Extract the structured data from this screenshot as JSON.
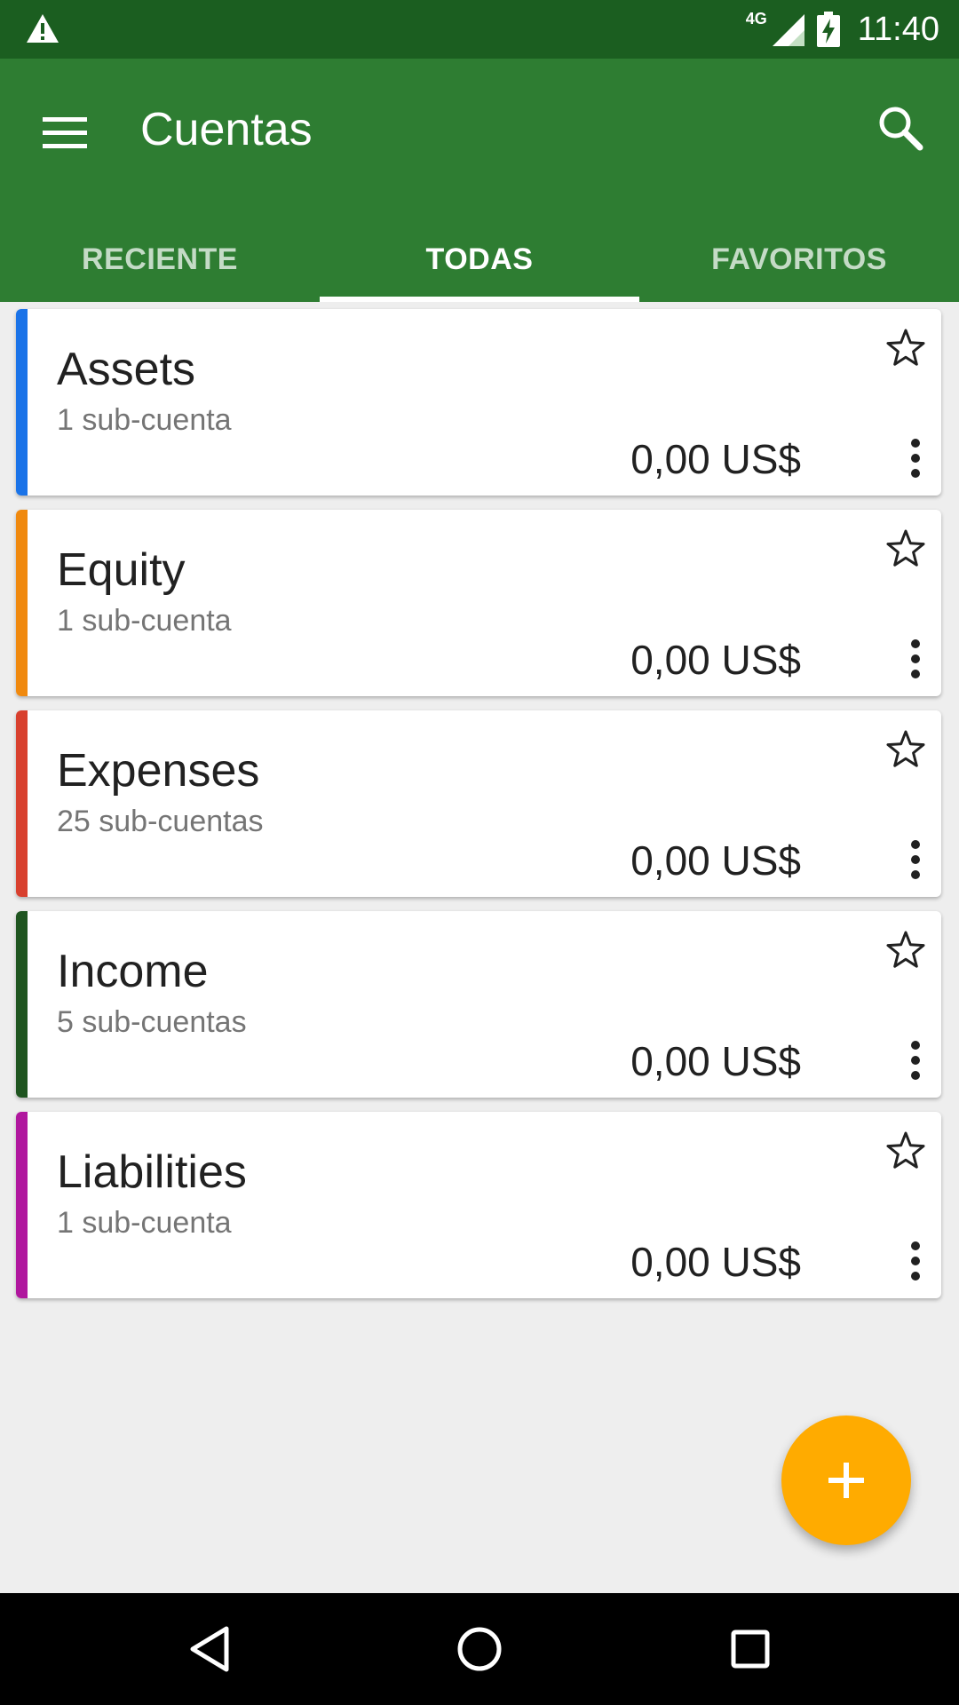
{
  "status_bar": {
    "network": "4G",
    "time": "11:40",
    "icons": [
      "warning-icon",
      "signal-icon",
      "battery-charging-icon"
    ]
  },
  "toolbar": {
    "title": "Cuentas",
    "menu_icon": "hamburger-menu-icon",
    "search_icon": "search-icon"
  },
  "tabs": [
    {
      "label": "RECIENTE",
      "active": false
    },
    {
      "label": "TODAS",
      "active": true
    },
    {
      "label": "FAVORITOS",
      "active": false
    }
  ],
  "accounts": [
    {
      "name": "Assets",
      "sub": "1 sub-cuenta",
      "balance": "0,00 US$",
      "color": "#1a73e8"
    },
    {
      "name": "Equity",
      "sub": "1 sub-cuenta",
      "balance": "0,00 US$",
      "color": "#f0890e"
    },
    {
      "name": "Expenses",
      "sub": "25 sub-cuentas",
      "balance": "0,00 US$",
      "color": "#d8402e"
    },
    {
      "name": "Income",
      "sub": "5 sub-cuentas",
      "balance": "0,00 US$",
      "color": "#1f5520"
    },
    {
      "name": "Liabilities",
      "sub": "1 sub-cuenta",
      "balance": "0,00 US$",
      "color": "#b0179e"
    }
  ],
  "fab": {
    "icon": "plus-icon",
    "color": "#ffab00"
  },
  "nav_bar": {
    "icons": [
      "back-icon",
      "home-icon",
      "recents-icon"
    ]
  },
  "colors": {
    "status_bar": "#1b5e20",
    "toolbar": "#2e7d32",
    "background": "#eeeeee"
  }
}
